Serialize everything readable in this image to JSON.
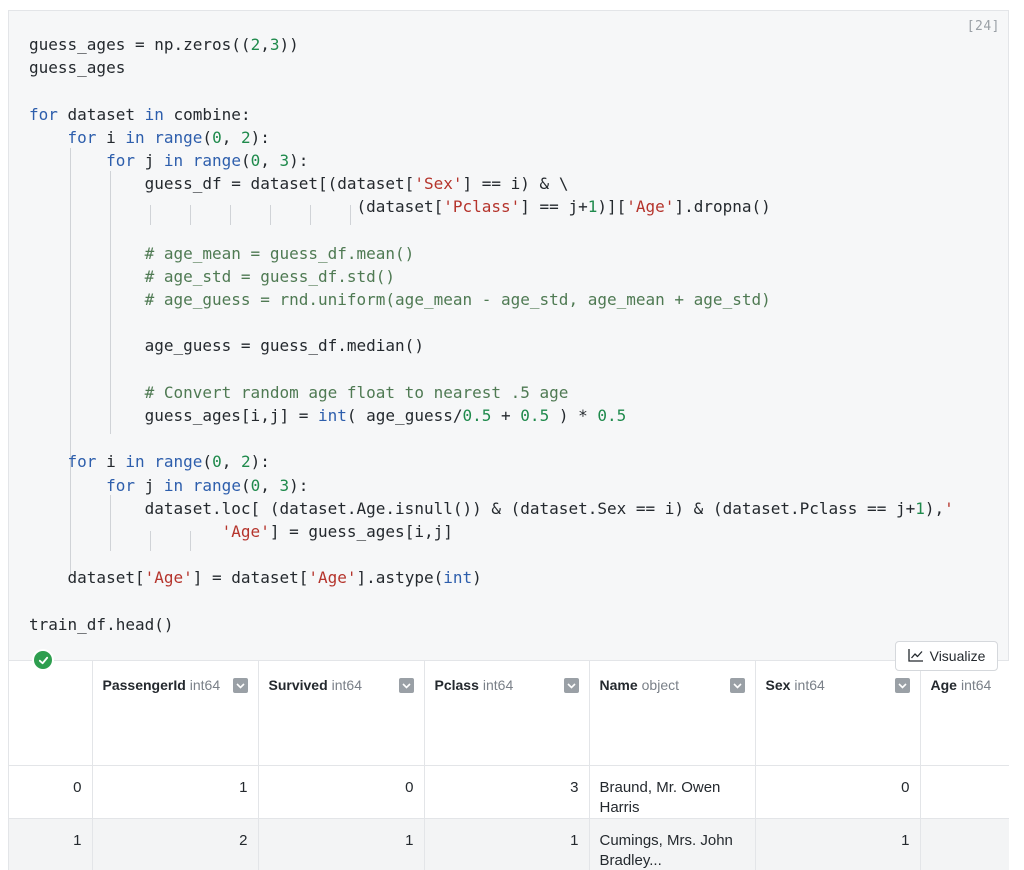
{
  "cell": {
    "execution_count": "[24]",
    "code_lines": [
      "guess_ages = np.zeros((2,3))",
      "guess_ages",
      "",
      "for dataset in combine:",
      "    for i in range(0, 2):",
      "        for j in range(0, 3):",
      "            guess_df = dataset[(dataset['Sex'] == i) & \\",
      "                                  (dataset['Pclass'] == j+1)]['Age'].dropna()",
      "",
      "            # age_mean = guess_df.mean()",
      "            # age_std = guess_df.std()",
      "            # age_guess = rnd.uniform(age_mean - age_std, age_mean + age_std)",
      "",
      "            age_guess = guess_df.median()",
      "",
      "            # Convert random age float to nearest .5 age",
      "            guess_ages[i,j] = int( age_guess/0.5 + 0.5 ) * 0.5",
      "",
      "    for i in range(0, 2):",
      "        for j in range(0, 3):",
      "            dataset.loc[ (dataset.Age.isnull()) & (dataset.Sex == i) & (dataset.Pclass == j+1),'",
      "                    'Age'] = guess_ages[i,j]",
      "",
      "    dataset['Age'] = dataset['Age'].astype(int)",
      "",
      "train_df.head()"
    ]
  },
  "output": {
    "visualize_label": "Visualize",
    "columns": [
      {
        "name": "PassengerId",
        "type": "int64"
      },
      {
        "name": "Survived",
        "type": "int64"
      },
      {
        "name": "Pclass",
        "type": "int64"
      },
      {
        "name": "Name",
        "type": "object"
      },
      {
        "name": "Sex",
        "type": "int64"
      },
      {
        "name": "Age",
        "type": "int64"
      }
    ],
    "rows": [
      {
        "index": "0",
        "PassengerId": "1",
        "Survived": "0",
        "Pclass": "3",
        "Name": "Braund, Mr. Owen Harris",
        "Sex": "0",
        "Age": ""
      },
      {
        "index": "1",
        "PassengerId": "2",
        "Survived": "1",
        "Pclass": "1",
        "Name": "Cumings, Mrs. John Bradley...",
        "Sex": "1",
        "Age": ""
      }
    ]
  },
  "colors": {
    "keyword": "#2d5eac",
    "string": "#b5342c",
    "number": "#1f8a4c",
    "comment": "#4f7a53",
    "success": "#2e9e4f"
  }
}
